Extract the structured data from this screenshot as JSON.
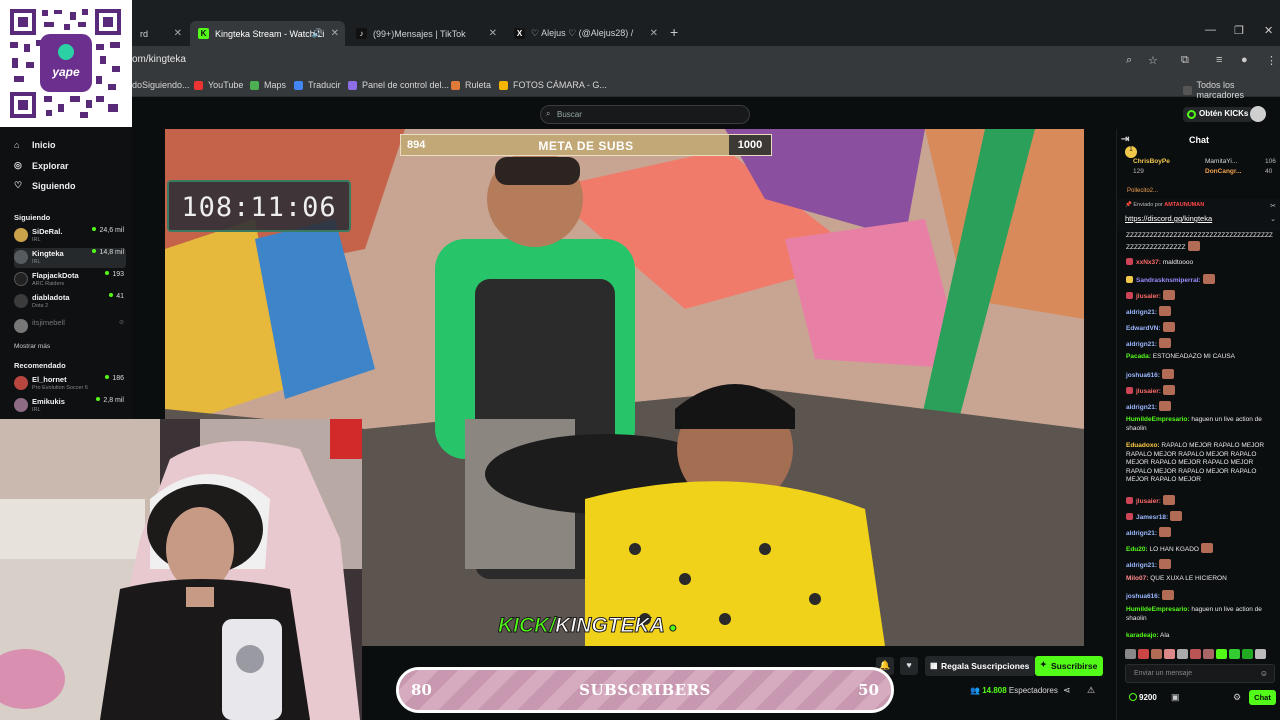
{
  "browser": {
    "tabs": [
      {
        "title": "rd",
        "active": false
      },
      {
        "title": "Kingteka Stream - Watch Li",
        "active": true
      },
      {
        "title": "(99+)Mensajes | TikTok",
        "active": false
      },
      {
        "title": "♡ Alejus ♡ (@Alejus28) /",
        "active": false
      }
    ],
    "new_tab": "+",
    "url": "om/kingteka",
    "bookmarks": [
      "doSiguiendo...",
      "YouTube",
      "Maps",
      "Traducir",
      "Panel de control del...",
      "Ruleta",
      "FOTOS CÁMARA - G..."
    ],
    "all_bookmarks": "Todos los marcadores"
  },
  "kick": {
    "search_placeholder": "Buscar",
    "get_kicks": "Obtén KICKs"
  },
  "sidebar": {
    "nav": [
      {
        "label": "Inicio",
        "icon": "home-icon"
      },
      {
        "label": "Explorar",
        "icon": "compass-icon"
      },
      {
        "label": "Siguiendo",
        "icon": "heart-icon"
      }
    ],
    "following_title": "Siguiendo",
    "following": [
      {
        "name": "SiDeRal.",
        "category": "IRL",
        "viewers": "24,6 mil",
        "color": "#c9a24a"
      },
      {
        "name": "Kingteka",
        "category": "IRL",
        "viewers": "14,8 mil",
        "color": "#555b5e"
      },
      {
        "name": "FlapjackDota",
        "category": "ARC Raiders",
        "viewers": "193",
        "color": "#222"
      },
      {
        "name": "diabladota",
        "category": "Dota 2",
        "viewers": "41",
        "color": "#3b3b3b"
      },
      {
        "name": "itsjimebell",
        "category": "",
        "viewers": "",
        "color": "#777"
      }
    ],
    "show_more": "Mostrar más",
    "recommended_title": "Recomendado",
    "recommended": [
      {
        "name": "El_hornet",
        "category": "Pro Evolution Soccer 6",
        "viewers": "186",
        "color": "#b7473e"
      },
      {
        "name": "Emikukis",
        "category": "IRL",
        "viewers": "2,8 mil",
        "color": "#8d6b84"
      }
    ]
  },
  "overlay": {
    "subs_current": "894",
    "subs_label": "META DE SUBS",
    "subs_target": "1000",
    "subs_progress": 0.894,
    "timer": "108:11:06",
    "brand_k": "KICK/",
    "brand_name": "KINGTEKA"
  },
  "player": {
    "gift_subs": "Regala Suscripciones",
    "subscribe": "Suscribirse",
    "viewers_count": "14.808",
    "viewers_label": "Espectadores"
  },
  "subgoal": {
    "left": "80",
    "label": "SUBSCRIBERS",
    "right": "50"
  },
  "chat": {
    "title": "Chat",
    "pins": [
      {
        "name": "ChrisBoyPe",
        "value": "129",
        "color": "#f2c84b"
      },
      {
        "name": "MamitaYi...",
        "value": "106",
        "color": "#d8d8d8"
      },
      {
        "name": "DonCangr...",
        "value": "40",
        "color": "#f0a050"
      },
      {
        "name": "Pollecito2...",
        "value": "",
        "color": "#f0a050"
      }
    ],
    "pinned_by_label": "Enviado por",
    "pinned_by": "AMTAUNUMAN",
    "pinned_link": "https://discord.gg/kingteka",
    "messages": [
      {
        "user": "",
        "text": "ZZZZZZZZZZZZZZZZZZZZZZZZZZZZZZZZZZZZZZZZZZZZZZZZZZZZ",
        "color": "#e8e8e8"
      },
      {
        "user": "xxNx37:",
        "text": "maldtoooo",
        "color": "#ff6b6b"
      },
      {
        "user": "SandrasknsmiperraI:",
        "text": "",
        "color": "#9b8cff"
      },
      {
        "user": "jlusaier:",
        "text": "",
        "color": "#ff6b6b"
      },
      {
        "user": "aldrign21:",
        "text": "",
        "color": "#9ab8ff"
      },
      {
        "user": "EdwardVN:",
        "text": "",
        "color": "#9ab8ff"
      },
      {
        "user": "aldrign21:",
        "text": "",
        "color": "#9ab8ff"
      },
      {
        "user": "Pacada:",
        "text": "ESTONEADAZO MI CAUSA",
        "color": "#53fc18"
      },
      {
        "user": "joshua616:",
        "text": "",
        "color": "#9ab8ff"
      },
      {
        "user": "jlusaier:",
        "text": "",
        "color": "#ff6b6b"
      },
      {
        "user": "aldrign21:",
        "text": "",
        "color": "#9ab8ff"
      },
      {
        "user": "HumildeEmpresario:",
        "text": "haguen un live action de shaolin",
        "color": "#53fc18"
      },
      {
        "user": "Eduadoxo:",
        "text": "RAPALO MEJOR RAPALO MEJOR RAPALO MEJOR RAPALO MEJOR RAPALO MEJOR RAPALO MEJOR RAPALO MEJOR RAPALO MEJOR RAPALO MEJOR RAPALO MEJOR RAPALO MEJOR",
        "color": "#ffcc44"
      },
      {
        "user": "jlusaier:",
        "text": "",
        "color": "#ff6b6b"
      },
      {
        "user": "Jamesr18:",
        "text": "",
        "color": "#9ab8ff"
      },
      {
        "user": "aldrign21:",
        "text": "",
        "color": "#9ab8ff"
      },
      {
        "user": "Edu20:",
        "text": "LO HAN KGADO",
        "color": "#53fc18"
      },
      {
        "user": "aldrign21:",
        "text": "",
        "color": "#9ab8ff"
      },
      {
        "user": "Milo07:",
        "text": "QUE XUXA LE HICIERON",
        "color": "#ff8a8a"
      },
      {
        "user": "joshua616:",
        "text": "",
        "color": "#9ab8ff"
      },
      {
        "user": "HumildeEmpresario:",
        "text": "haguen un live action de shaolin",
        "color": "#53fc18"
      },
      {
        "user": "karadeajo:",
        "text": "Ala",
        "color": "#53fc18"
      }
    ],
    "input_placeholder": "Enviar un mensaje",
    "kicks_balance": "9200",
    "chat_button": "Chat"
  },
  "colors": {
    "accent": "#53fc18",
    "background": "#0b0e0f"
  }
}
